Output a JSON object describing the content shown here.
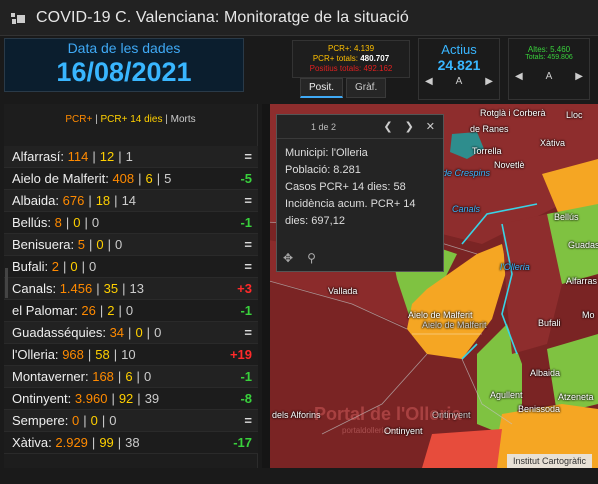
{
  "app": {
    "title": "COVID-19 C. Valenciana: Monitoratge de la situació"
  },
  "date_panel": {
    "label": "Data de les dades",
    "value": "16/08/2021"
  },
  "pcr_panel": {
    "line1": "PCR+: 4.139",
    "line2_label": "PCR+ totals:",
    "line2_value": "480.707",
    "line3": "Positius totals: 492.162",
    "tabs": [
      "Posit.",
      "Gràf."
    ]
  },
  "actius_panel": {
    "title": "Actius",
    "value": "24.821",
    "nav_label": "A"
  },
  "altes_panel": {
    "line1": "Altes: 5.460",
    "line2": "Totals: 459.806",
    "nav_label": "A"
  },
  "list": {
    "header": {
      "pcr": "PCR+",
      "sep1": "|",
      "pcr14": "PCR+ 14 dies",
      "sep2": "|",
      "morts": "Morts"
    },
    "rows": [
      {
        "name": "Alfarrasí:",
        "pcr": "114",
        "pcr14": "12",
        "morts": "1",
        "trend": "="
      },
      {
        "name": "Aielo de Malferit:",
        "pcr": "408",
        "pcr14": "6",
        "morts": "5",
        "trend": "-5"
      },
      {
        "name": "Albaida:",
        "pcr": "676",
        "pcr14": "18",
        "morts": "14",
        "trend": "="
      },
      {
        "name": "Bellús:",
        "pcr": "8",
        "pcr14": "0",
        "morts": "0",
        "trend": "-1"
      },
      {
        "name": "Benisuera:",
        "pcr": "5",
        "pcr14": "0",
        "morts": "0",
        "trend": "="
      },
      {
        "name": "Bufali:",
        "pcr": "2",
        "pcr14": "0",
        "morts": "0",
        "trend": "="
      },
      {
        "name": "Canals:",
        "pcr": "1.456",
        "pcr14": "35",
        "morts": "13",
        "trend": "+3"
      },
      {
        "name": "el Palomar:",
        "pcr": "26",
        "pcr14": "2",
        "morts": "0",
        "trend": "-1"
      },
      {
        "name": "Guadasséquies:",
        "pcr": "34",
        "pcr14": "0",
        "morts": "0",
        "trend": "="
      },
      {
        "name": "l'Olleria:",
        "pcr": "968",
        "pcr14": "58",
        "morts": "10",
        "trend": "+19"
      },
      {
        "name": "Montaverner:",
        "pcr": "168",
        "pcr14": "6",
        "morts": "0",
        "trend": "-1"
      },
      {
        "name": "Ontinyent:",
        "pcr": "3.960",
        "pcr14": "92",
        "morts": "39",
        "trend": "-8"
      },
      {
        "name": "Sempere:",
        "pcr": "0",
        "pcr14": "0",
        "morts": "0",
        "trend": "="
      },
      {
        "name": "Xàtiva:",
        "pcr": "2.929",
        "pcr14": "99",
        "morts": "38",
        "trend": "-17"
      }
    ]
  },
  "popup": {
    "page": "1 de 2",
    "lines": [
      "Municipi: l'Olleria",
      "Població: 8.281",
      "Casos PCR+ 14 dies: 58",
      "Incidència acum. PCR+ 14",
      "dies: 697,12"
    ]
  },
  "map": {
    "labels": {
      "rotgla": "Rotglà i Corberà",
      "ranes": "de Ranes",
      "llocnou": "Lloc",
      "torrella": "Torrella",
      "novetle": "Novetlè",
      "xativa": "Xàtiva",
      "crespins": "de Crespins",
      "canals": "Canals",
      "bellus": "Bellús",
      "guadas": "Guadas",
      "olleria": "l'Olleria",
      "alfarrasi": "Alfarras",
      "vallada": "Vallada",
      "aielo": "Aielo de Malferit",
      "aielo_dim": "Aielo de Malferit",
      "bufali": "Bufali",
      "montaverner": "Mo",
      "albaida": "Albaida",
      "agullent": "Agullent",
      "atzeneta": "Atzeneta",
      "benissoda": "Benissoda",
      "alfafors": "dels Alforins",
      "ontinyent": "Ontinyent",
      "ontinyent2": "Ontinyent"
    },
    "attribution": "Institut Cartogràfic",
    "watermark": "Portal de l'Olleria",
    "watermark_sub": "portaldolleria.es"
  },
  "colors": {
    "accent_blue": "#39b6ff",
    "pcr_orange": "#ff8a00",
    "pcr14_yellow": "#ffd000",
    "green": "#39d13c",
    "red": "#ff2a2a",
    "map_red": "#7a2424",
    "map_orange": "#f5a623",
    "map_green": "#7fc241"
  }
}
